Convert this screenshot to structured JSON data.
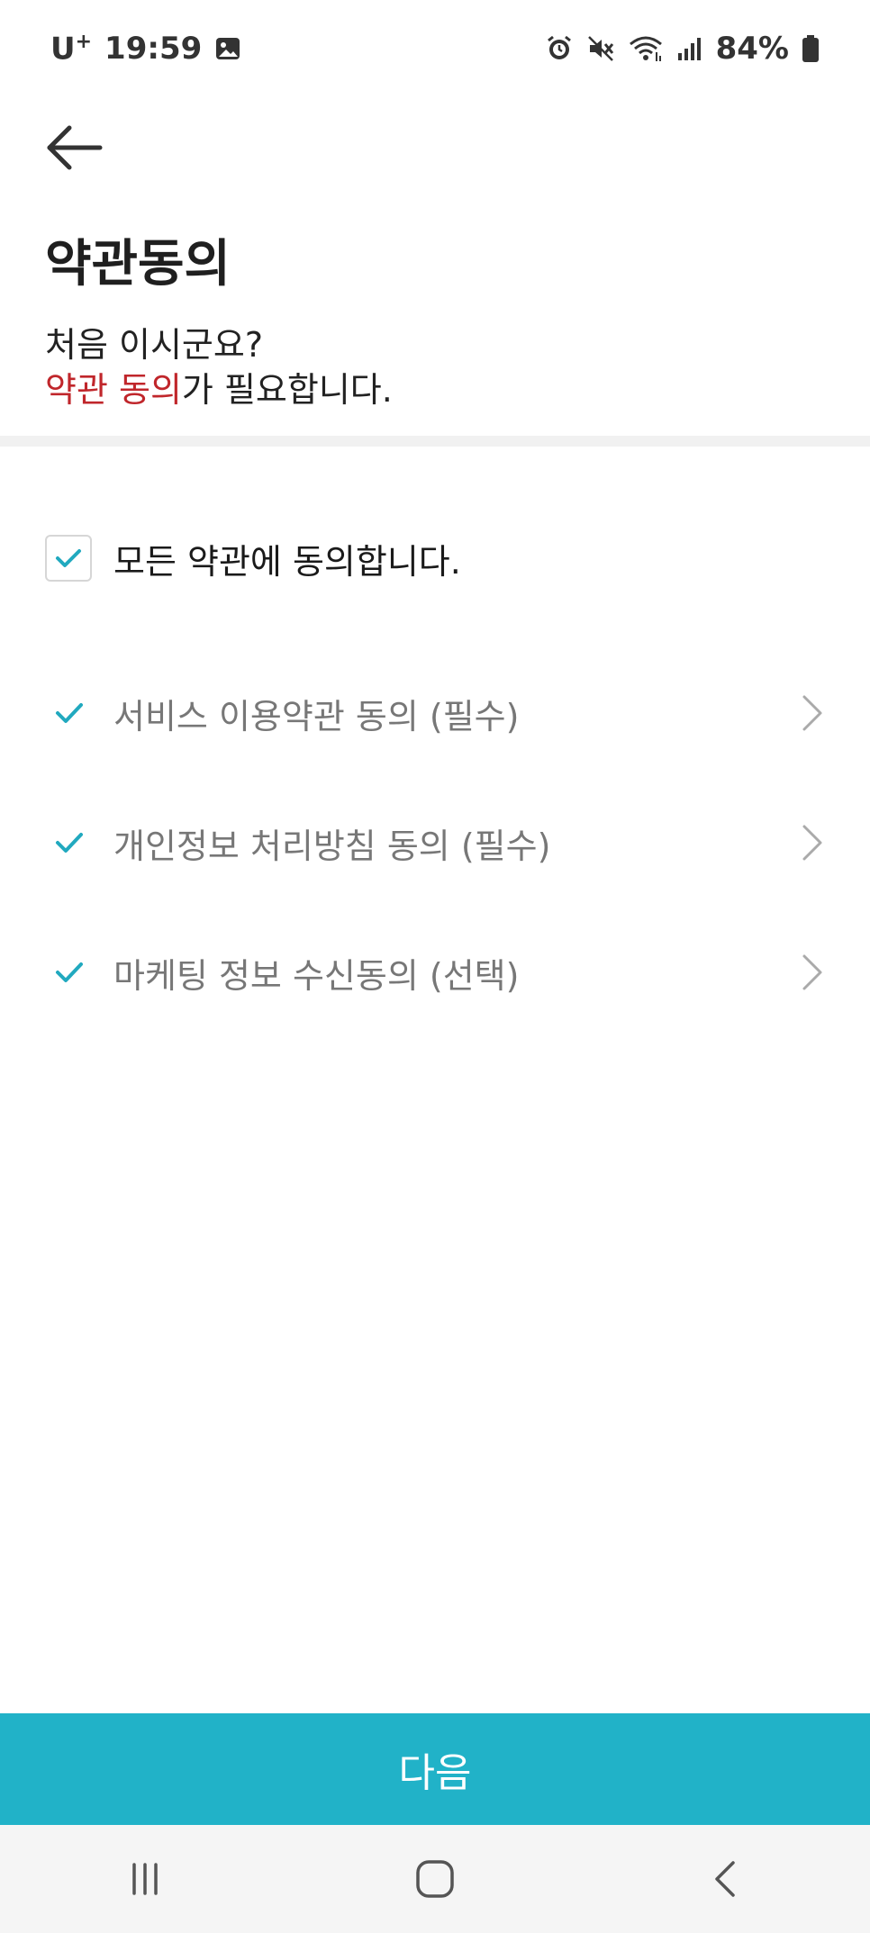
{
  "status_bar": {
    "carrier": "U",
    "carrier_sup": "+",
    "time": "19:59",
    "battery": "84%"
  },
  "page": {
    "title": "약관동의",
    "intro_line1": "처음 이시군요?",
    "intro_accent": "약관 동의",
    "intro_rest": "가 필요합니다."
  },
  "agreement": {
    "all_label": "모든 약관에 동의합니다.",
    "all_checked": true,
    "items": [
      {
        "label": "서비스 이용약관 동의 (필수)",
        "checked": true
      },
      {
        "label": "개인정보 처리방침 동의 (필수)",
        "checked": true
      },
      {
        "label": "마케팅 정보 수신동의 (선택)",
        "checked": true
      }
    ]
  },
  "actions": {
    "next_label": "다음"
  },
  "colors": {
    "accent": "#21b2c8",
    "highlight": "#c0262b",
    "check": "#21a9bf"
  },
  "icons": {
    "back": "arrow-left-icon",
    "check": "checkmark-icon",
    "chevron": "chevron-right-icon",
    "nav_recent": "recent-apps-icon",
    "nav_home": "home-icon",
    "nav_back": "nav-back-icon"
  }
}
